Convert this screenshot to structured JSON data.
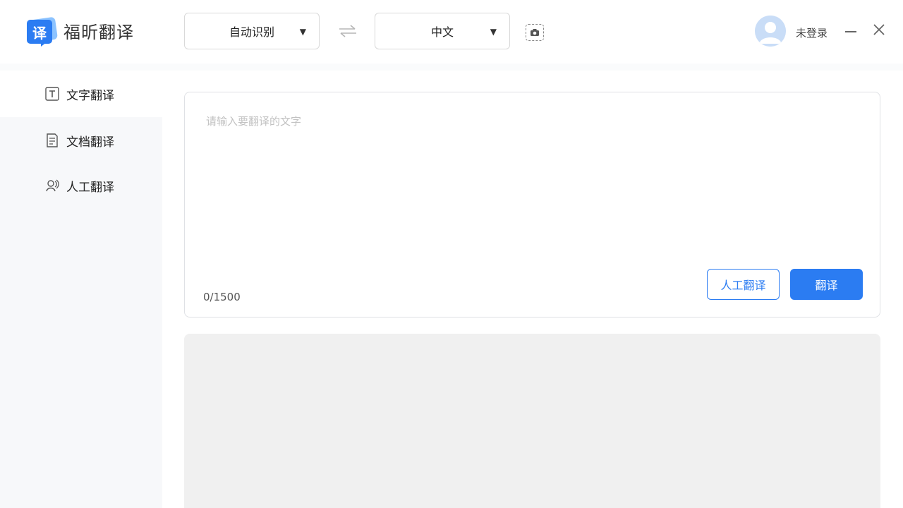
{
  "app": {
    "logo_char": "译",
    "name": "福昕翻译"
  },
  "toolbar": {
    "source_lang": "自动识别",
    "target_lang": "中文",
    "caret": "▼"
  },
  "user": {
    "login_label": "未登录"
  },
  "sidebar": {
    "items": [
      {
        "label": "文字翻译",
        "icon": "text-icon",
        "active": true
      },
      {
        "label": "文档翻译",
        "icon": "document-icon",
        "active": false
      },
      {
        "label": "人工翻译",
        "icon": "human-translate-icon",
        "active": false
      }
    ]
  },
  "editor": {
    "placeholder": "请输入要翻译的文字",
    "value": "",
    "char_count": "0/1500",
    "human_button": "人工翻译",
    "translate_button": "翻译"
  },
  "colors": {
    "accent": "#2b7cf2",
    "result_bg": "#f0f0f0",
    "sidebar_bg": "#f7f8fa"
  }
}
